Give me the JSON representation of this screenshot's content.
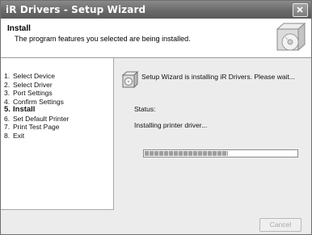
{
  "window": {
    "title": "iR Drivers - Setup Wizard"
  },
  "header": {
    "title": "Install",
    "subtitle": "The program features you selected are being installed."
  },
  "steps": [
    {
      "number": "1.",
      "label": "Select Device",
      "active": false
    },
    {
      "number": "2.",
      "label": "Select Driver",
      "active": false
    },
    {
      "number": "3.",
      "label": "Port Settings",
      "active": false
    },
    {
      "number": "4.",
      "label": "Confirm Settings",
      "active": false
    },
    {
      "number": "5.",
      "label": "Install",
      "active": true
    },
    {
      "number": "6.",
      "label": "Set Default Printer",
      "active": false
    },
    {
      "number": "7.",
      "label": "Print Test Page",
      "active": false
    },
    {
      "number": "8.",
      "label": "Exit",
      "active": false
    }
  ],
  "main": {
    "message": "Setup Wizard is installing iR Drivers. Please wait...",
    "status_label": "Status:",
    "status_text": "Installing printer driver...",
    "progress_fraction": 0.55
  },
  "footer": {
    "cancel_label": "Cancel"
  },
  "colors": {
    "titlebar": "#6a6a6a",
    "panel": "#ececec"
  }
}
